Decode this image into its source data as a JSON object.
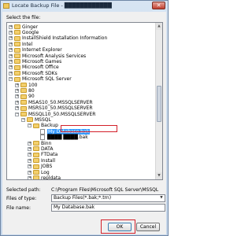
{
  "window": {
    "title": "Locate Backup File - ████████████",
    "close_label": "✕"
  },
  "tree": {
    "label": "Select the file:",
    "rows": [
      {
        "name": "Ginger",
        "depth": 0,
        "exp": "+",
        "kind": "folder"
      },
      {
        "name": "Google",
        "depth": 0,
        "exp": "+",
        "kind": "folder"
      },
      {
        "name": "InstallShield Installation Information",
        "depth": 0,
        "exp": "+",
        "kind": "folder"
      },
      {
        "name": "Intel",
        "depth": 0,
        "exp": "+",
        "kind": "folder"
      },
      {
        "name": "Internet Explorer",
        "depth": 0,
        "exp": "+",
        "kind": "folder"
      },
      {
        "name": "Microsoft Analysis Services",
        "depth": 0,
        "exp": "+",
        "kind": "folder"
      },
      {
        "name": "Microsoft Games",
        "depth": 0,
        "exp": "+",
        "kind": "folder"
      },
      {
        "name": "Microsoft Office",
        "depth": 0,
        "exp": "+",
        "kind": "folder"
      },
      {
        "name": "Microsoft SDKs",
        "depth": 0,
        "exp": "+",
        "kind": "folder"
      },
      {
        "name": "Microsoft SQL Server",
        "depth": 0,
        "exp": "−",
        "kind": "folder"
      },
      {
        "name": "100",
        "depth": 1,
        "exp": "+",
        "kind": "folder"
      },
      {
        "name": "80",
        "depth": 1,
        "exp": "+",
        "kind": "folder"
      },
      {
        "name": "90",
        "depth": 1,
        "exp": "+",
        "kind": "folder"
      },
      {
        "name": "MSAS10_50.MSSQLSERVER",
        "depth": 1,
        "exp": "+",
        "kind": "folder"
      },
      {
        "name": "MSRS10_50.MSSQLSERVER",
        "depth": 1,
        "exp": "+",
        "kind": "folder"
      },
      {
        "name": "MSSQL10_50.MSSQLSERVER",
        "depth": 1,
        "exp": "−",
        "kind": "folder"
      },
      {
        "name": "MSSQL",
        "depth": 2,
        "exp": "−",
        "kind": "folder"
      },
      {
        "name": "Backup",
        "depth": 3,
        "exp": "−",
        "kind": "folder"
      },
      {
        "name": "My Database.bak",
        "depth": 4,
        "exp": "",
        "kind": "file",
        "selected": true
      },
      {
        "name": "████ ████.bak",
        "depth": 4,
        "exp": "",
        "kind": "file"
      },
      {
        "name": "Binn",
        "depth": 3,
        "exp": "+",
        "kind": "folder"
      },
      {
        "name": "DATA",
        "depth": 3,
        "exp": "+",
        "kind": "folder"
      },
      {
        "name": "FTData",
        "depth": 3,
        "exp": "+",
        "kind": "folder"
      },
      {
        "name": "Install",
        "depth": 3,
        "exp": "+",
        "kind": "folder"
      },
      {
        "name": "JOBS",
        "depth": 3,
        "exp": "+",
        "kind": "folder"
      },
      {
        "name": "Log",
        "depth": 3,
        "exp": "+",
        "kind": "folder"
      },
      {
        "name": "repldata",
        "depth": 3,
        "exp": "+",
        "kind": "folder"
      }
    ]
  },
  "form": {
    "path_label": "Selected path:",
    "path_value": "C:\\Program Files\\Microsoft SQL Server\\MSSQL",
    "filetype_label": "Files of type:",
    "filetype_value": "Backup Files(*.bak;*.trn)",
    "filename_label": "File name:",
    "filename_value": "My Database.bak"
  },
  "buttons": {
    "ok": "OK",
    "cancel": "Cancel"
  },
  "colors": {
    "highlight": "#d3202a",
    "selection": "#3399ff"
  }
}
